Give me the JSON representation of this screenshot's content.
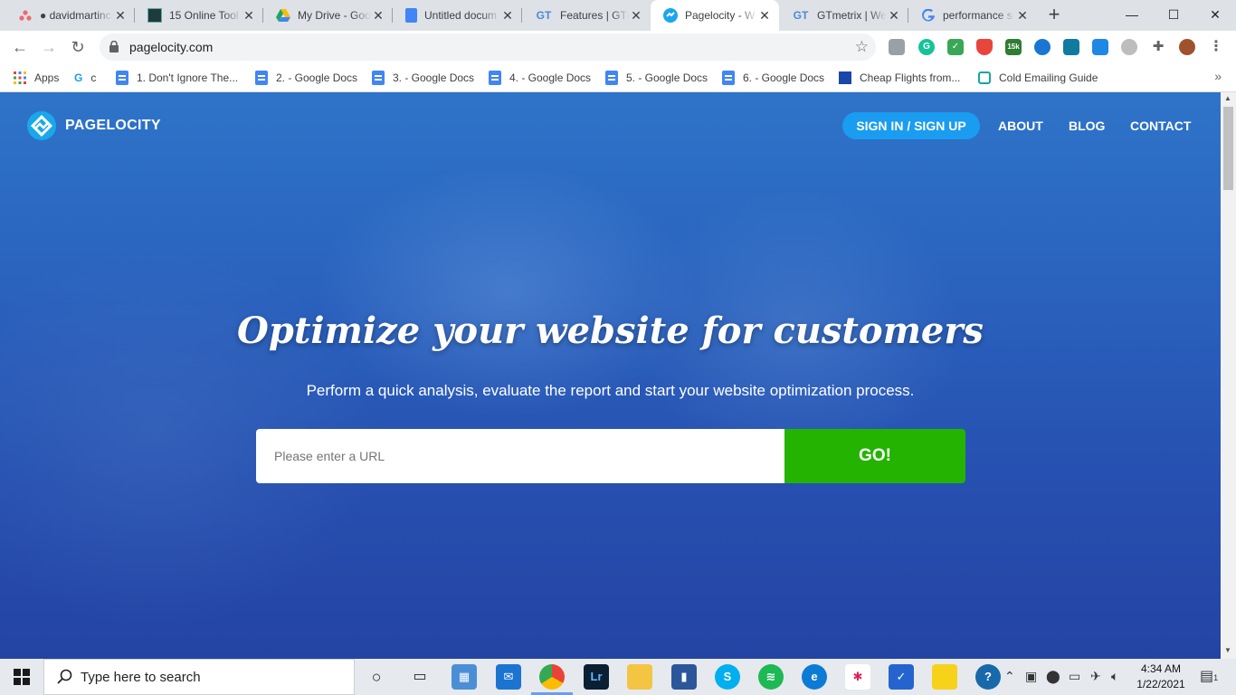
{
  "tabs": [
    {
      "title": "● davidmartinc",
      "icon": "asana-icon",
      "active": false
    },
    {
      "title": "15 Online Tool",
      "icon": "site-icon",
      "active": false
    },
    {
      "title": "My Drive - Goo",
      "icon": "google-drive-icon",
      "active": false
    },
    {
      "title": "Untitled docum",
      "icon": "google-docs-icon",
      "active": false
    },
    {
      "title": "Features | GTm",
      "icon": "gtmetrix-icon",
      "active": false
    },
    {
      "title": "Pagelocity - W",
      "icon": "pagelocity-icon",
      "active": true
    },
    {
      "title": "GTmetrix | Wel",
      "icon": "gtmetrix-icon",
      "active": false
    },
    {
      "title": "performance s",
      "icon": "google-icon",
      "active": false
    }
  ],
  "window_controls": {
    "minimize": "—",
    "maximize": "☐",
    "close": "✕"
  },
  "address_bar": {
    "url": "pagelocity.com"
  },
  "extensions": [
    {
      "name": "camera-extension-icon",
      "color": "#9aa0a6"
    },
    {
      "name": "grammarly-extension-icon",
      "color": "#15c39a",
      "label": "G"
    },
    {
      "name": "checklist-extension-icon",
      "color": "#3aa757"
    },
    {
      "name": "shield-extension-icon",
      "color": "#e8453c"
    },
    {
      "name": "counter-extension-icon",
      "color": "#2e7d32",
      "label": "15k"
    },
    {
      "name": "rocket-extension-icon",
      "color": "#1976d2"
    },
    {
      "name": "reader-extension-icon",
      "color": "#0f7b9e"
    },
    {
      "name": "blue-square-extension-icon",
      "color": "#1e88e5"
    },
    {
      "name": "gray-circle-extension-icon",
      "color": "#bdbdbd"
    }
  ],
  "bookmarks": {
    "apps_label": "Apps",
    "c_label": "c",
    "items": [
      "1. Don't Ignore The...",
      "2. - Google Docs",
      "3. - Google Docs",
      "4. - Google Docs",
      "5. - Google Docs",
      "6. - Google Docs",
      "Cheap Flights from...",
      "Cold Emailing Guide"
    ],
    "more": "»"
  },
  "site": {
    "brand": "PAGELOCITY",
    "nav": {
      "signin": "SIGN IN / SIGN UP",
      "about": "ABOUT",
      "blog": "BLOG",
      "contact": "CONTACT"
    },
    "hero_title": "Optimize your website for customers",
    "hero_subtitle": "Perform a quick analysis, evaluate the report and start your website optimization process.",
    "url_placeholder": "Please enter a URL",
    "go_label": "GO!",
    "colors": {
      "go": "#23b300",
      "signin": "#1a9cf0",
      "hero_bg": "#2a5cbb"
    }
  },
  "taskbar": {
    "search_placeholder": "Type here to search",
    "time": "4:34 AM",
    "date": "1/22/2021",
    "notification_count": "1"
  }
}
